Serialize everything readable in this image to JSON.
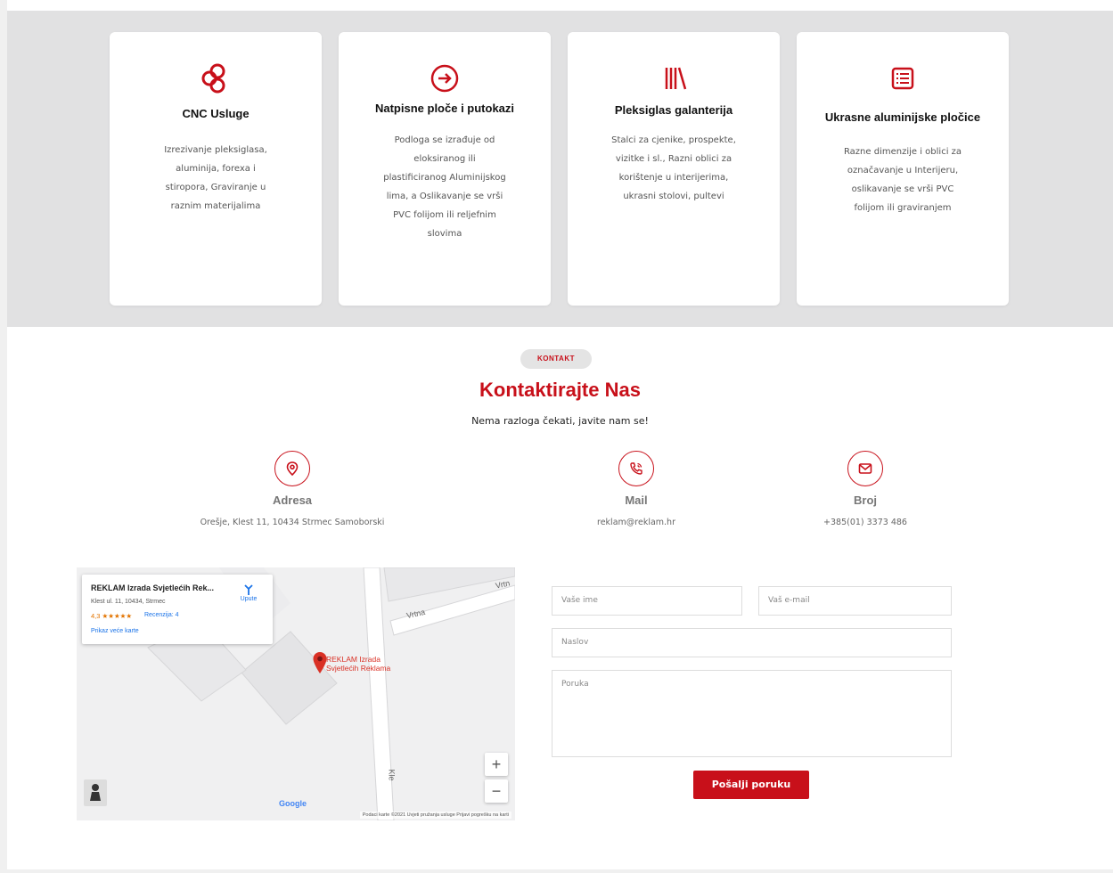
{
  "services": [
    {
      "title": "CNC Usluge",
      "desc": "Izrezivanje pleksiglasa, aluminija, forexa i stiropora, Graviranje u raznim materijalima",
      "icon": "cnc-icon"
    },
    {
      "title": "Natpisne ploče i putokazi",
      "desc": "Podloga se izrađuje od eloksiranog ili plastificiranog Aluminijskog lima, a Oslikavanje se vrši PVC folijom ili reljefnim slovima",
      "icon": "arrow-circle-icon"
    },
    {
      "title": "Pleksiglas galanterija",
      "desc": "Stalci za cjenike, prospekte, vizitke i sl., Razni oblici za korištenje u interijerima, ukrasni stolovi, pultevi",
      "icon": "library-icon"
    },
    {
      "title": "Ukrasne aluminijske pločice",
      "desc": "Razne dimenzije i oblici za označavanje u Interijeru, oslikavanje se vrši PVC folijom ili graviranjem",
      "icon": "list-icon"
    }
  ],
  "contact": {
    "badge": "KONTAKT",
    "title": "Kontaktirajte Nas",
    "subtitle": "Nema razloga čekati, javite nam se!",
    "address_label": "Adresa",
    "address_value": "Orešje, Klest 11, 10434 Strmec Samoborski",
    "mail_label": "Mail",
    "mail_value": "reklam@reklam.hr",
    "phone_label": "Broj",
    "phone_value": "+385(01) 3373 486"
  },
  "map": {
    "place_name": "REKLAM Izrada Svjetlećih Rek...",
    "place_address": "Klest ul. 11, 10434, Strmec",
    "rating": "4,3 ★★★★★",
    "reviews": "Recenzija: 4",
    "larger_map": "Prikaz veće karte",
    "directions": "Upute",
    "pin_label_1": "REKLAM Izrada",
    "pin_label_2": "Svjetlećih Reklama",
    "street_1": "Vrtna",
    "street_2": "Vrtn",
    "street_3": "Kle",
    "zoom_in": "+",
    "zoom_out": "−",
    "google": "Google",
    "footer": "Podaci karte ©2021   Uvjeti pružanja usluge   Prijavi pogrešku na karti"
  },
  "form": {
    "name_placeholder": "Vaše ime",
    "email_placeholder": "Vaš e-mail",
    "subject_placeholder": "Naslov",
    "message_placeholder": "Poruka",
    "submit": "Pošalji poruku"
  },
  "colors": {
    "accent": "#c8101a",
    "band": "#e1e1e2"
  }
}
